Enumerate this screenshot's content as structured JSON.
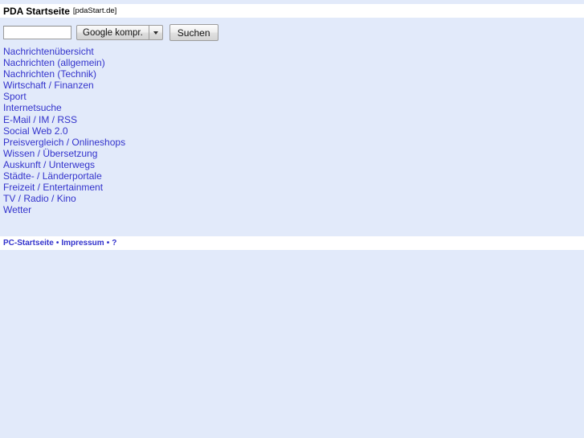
{
  "header": {
    "title": "PDA Startseite",
    "subtitle": "[pdaStart.de]"
  },
  "search": {
    "query_value": "",
    "query_placeholder": "",
    "engine_label": "Google kompr.",
    "dropdown_icon": "chevron-down-icon",
    "submit_label": "Suchen"
  },
  "categories": [
    {
      "label": "Nachrichtenübersicht"
    },
    {
      "label": "Nachrichten (allgemein)"
    },
    {
      "label": "Nachrichten (Technik)"
    },
    {
      "label": "Wirtschaft / Finanzen"
    },
    {
      "label": "Sport"
    },
    {
      "label": "Internetsuche"
    },
    {
      "label": "E-Mail / IM / RSS"
    },
    {
      "label": "Social Web 2.0"
    },
    {
      "label": "Preisvergleich / Onlineshops"
    },
    {
      "label": "Wissen / Übersetzung"
    },
    {
      "label": "Auskunft / Unterwegs"
    },
    {
      "label": "Städte- / Länderportale"
    },
    {
      "label": "Freizeit / Entertainment"
    },
    {
      "label": "TV / Radio / Kino"
    },
    {
      "label": "Wetter"
    }
  ],
  "footer": {
    "links": [
      {
        "label": "PC-Startseite"
      },
      {
        "label": "Impressum"
      },
      {
        "label": "?"
      }
    ],
    "separator": "•"
  },
  "colors": {
    "page_background": "#e2eafa",
    "band_background": "#ffffff",
    "link": "#3333cc",
    "text": "#000000"
  }
}
